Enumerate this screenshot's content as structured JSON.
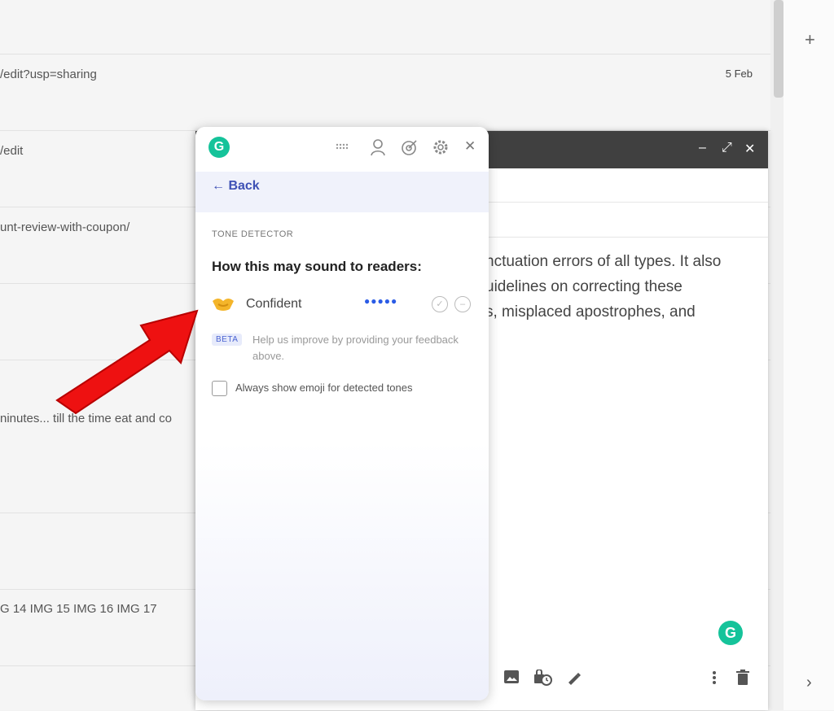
{
  "inbox": {
    "rows": [
      {
        "text": "/edit?usp=sharing",
        "date": "5 Feb"
      },
      {
        "text": "/edit",
        "date": ""
      },
      {
        "text": "unt-review-with-coupon/",
        "date": ""
      },
      {
        "text": "ninutes... till the time eat and co",
        "date": ""
      },
      {
        "text": "G 14 IMG 15 IMG 16 IMG 17",
        "date": ""
      }
    ]
  },
  "compose": {
    "body_lines": [
      "nctuation errors of all types. It also",
      "uidelines on correcting these",
      "s, misplaced apostrophes, and"
    ],
    "grammarly_badge": "G",
    "controls": {
      "minimize": "–",
      "expand": "⤢",
      "close": "✕"
    }
  },
  "grammarly": {
    "logo": "G",
    "back_label": "← Back",
    "section_label": "TONE DETECTOR",
    "heading": "How this may sound to readers:",
    "tone": {
      "label": "Confident",
      "dots": "●●●●●"
    },
    "beta_badge": "BETA",
    "beta_text": "Help us improve by providing your feedback above.",
    "checkbox_label": "Always show emoji for detected tones"
  },
  "rail": {
    "plus": "+",
    "chevron": "›"
  },
  "colors": {
    "grammarly_green": "#15c39a",
    "accent_blue": "#3e51b5",
    "arrow_red": "#ee1111"
  }
}
